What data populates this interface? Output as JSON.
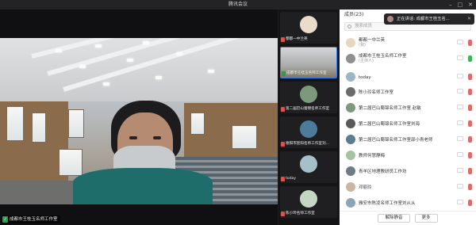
{
  "window": {
    "title": "腾讯会议"
  },
  "main_video": {
    "speaker_label": "成都市王桂玉名师工作室"
  },
  "thumbnails": [
    {
      "label": "都都一中兰英",
      "mic": "muted"
    },
    {
      "label": "成都市王桂玉名师工作室",
      "mic": "on"
    },
    {
      "label": "第二届巴山蜀锦名师工作室",
      "mic": "muted"
    },
    {
      "label": "德阳市旌阳名师工作室刘...",
      "mic": "muted"
    },
    {
      "label": "today",
      "mic": "muted"
    },
    {
      "label": "陈小玲名师工作室",
      "mic": "muted"
    }
  ],
  "panel": {
    "title": "成员(23)",
    "search_placeholder": "搜索成员",
    "members": [
      {
        "name": "都都一中兰英",
        "sub": "(我)",
        "mic": "muted"
      },
      {
        "name": "成都市王桂玉名师工作室",
        "sub": "(主持人)",
        "mic": "on"
      },
      {
        "name": "today",
        "sub": "",
        "mic": "muted"
      },
      {
        "name": "陈小玲名师工作室",
        "sub": "",
        "mic": "muted"
      },
      {
        "name": "第二届巴山蜀锦名师工作室 赵敏",
        "sub": "",
        "mic": "muted"
      },
      {
        "name": "第二届巴山蜀锦名师工作室刘海",
        "sub": "",
        "mic": "muted"
      },
      {
        "name": "第二届巴山蜀锦名师工作室邵小青老师",
        "sub": "",
        "mic": "muted"
      },
      {
        "name": "教师何慧静梅",
        "sub": "",
        "mic": "muted"
      },
      {
        "name": "青羊区地理教研员工作坊",
        "sub": "",
        "mic": "muted"
      },
      {
        "name": "邓丽玲",
        "sub": "",
        "mic": "muted"
      },
      {
        "name": "雅安市陈凌名师工作室刘从从",
        "sub": "",
        "mic": "muted"
      }
    ],
    "unmute_all_label": "解除静音",
    "more_label": "更多"
  },
  "toast": {
    "text": "正在讲话: 成都市王桂玉名..."
  },
  "colors": {
    "accent": "#2d7bf0",
    "mic_on": "#3cb557",
    "mic_muted": "#e06a6a"
  }
}
